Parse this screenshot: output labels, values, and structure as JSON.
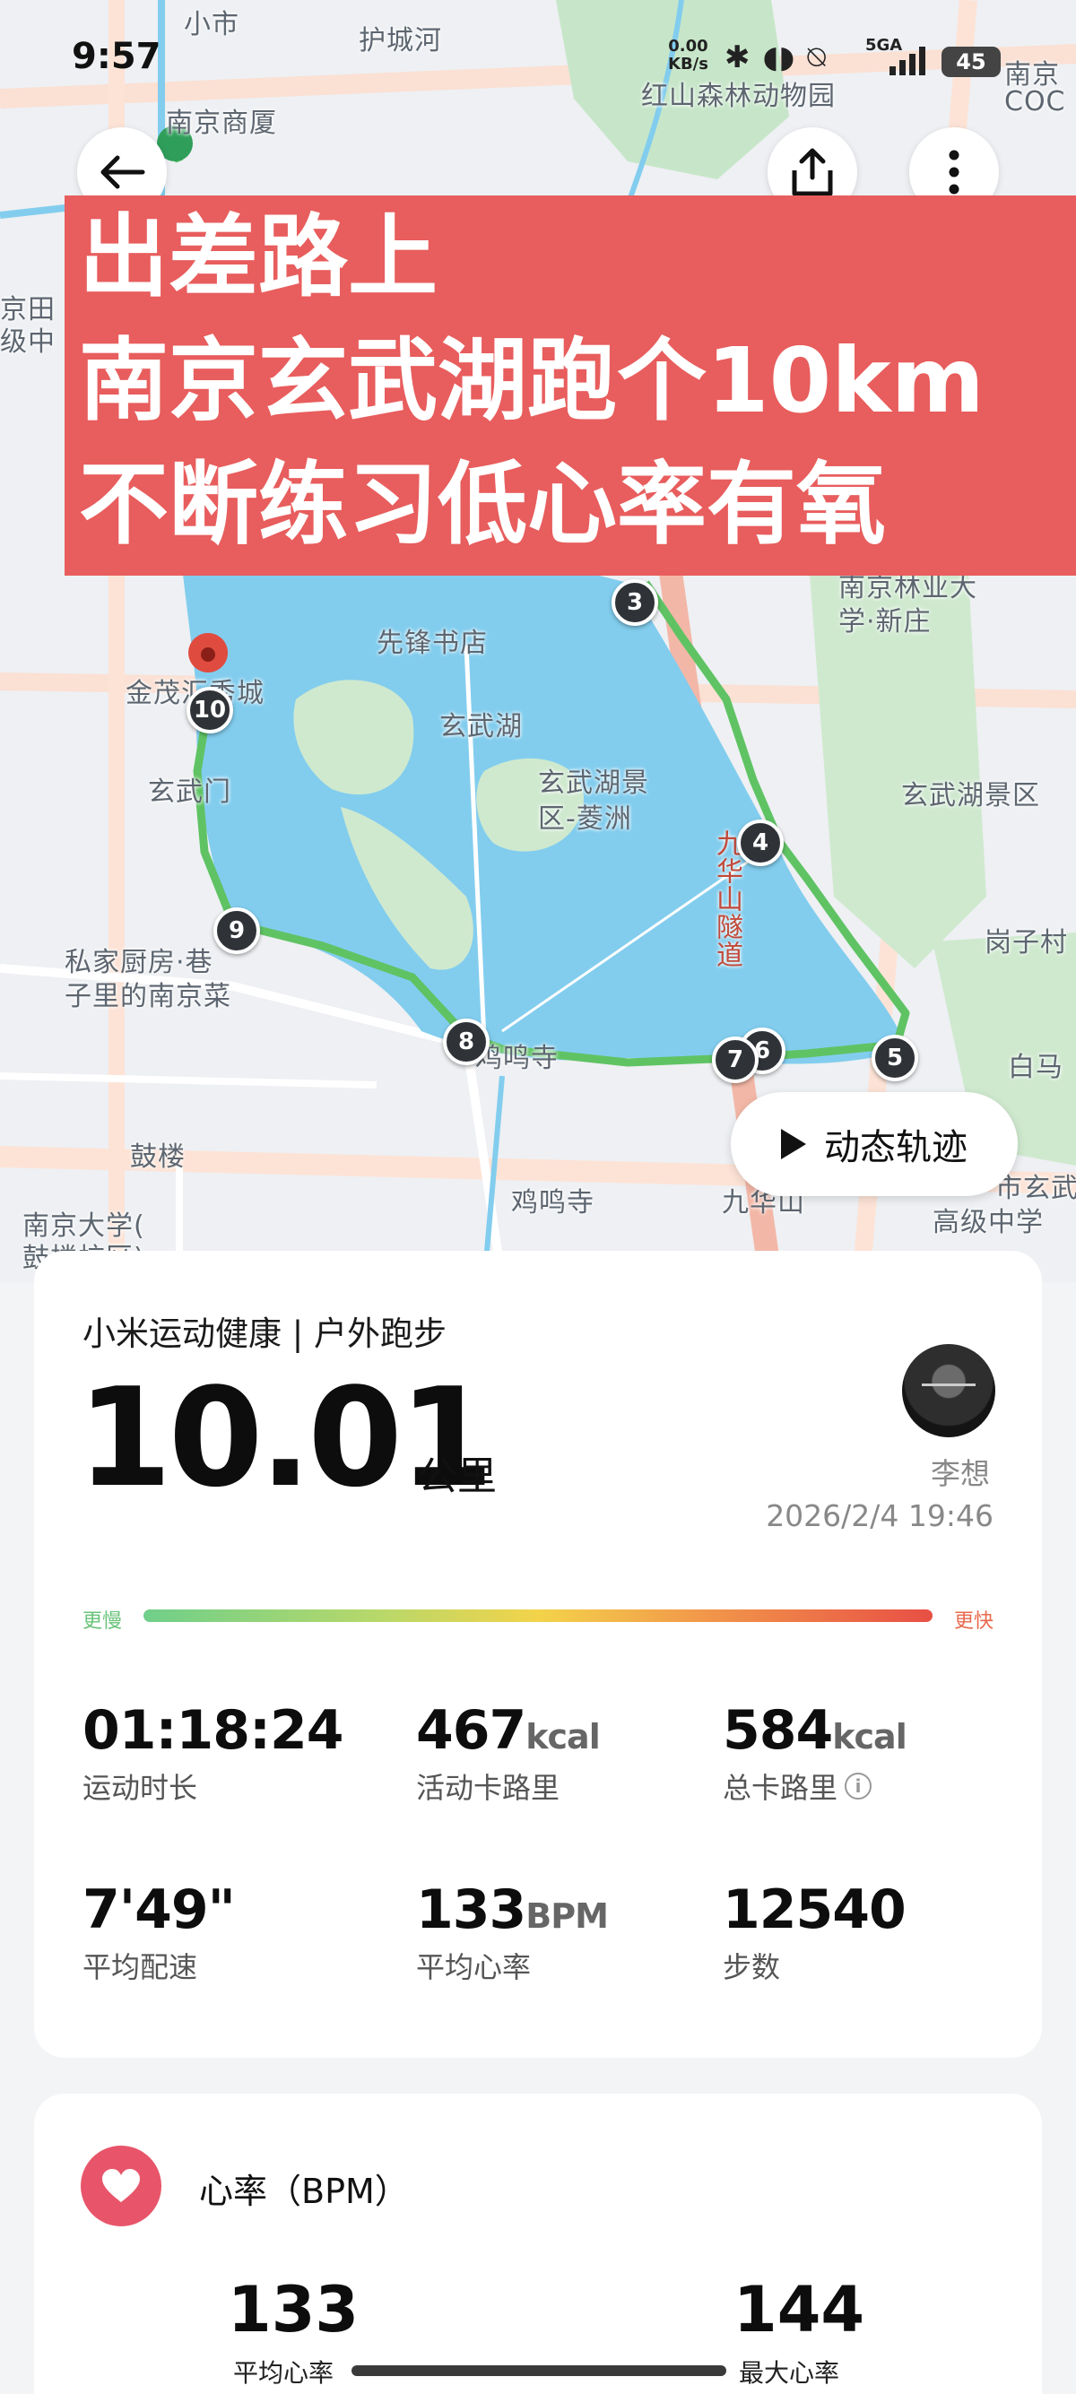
{
  "status_bar": {
    "time": "9:57",
    "net_speed_value": "0.00",
    "net_speed_unit": "KB/s",
    "network": "5GA",
    "battery": "45"
  },
  "map": {
    "labels": [
      "小市",
      "护城河",
      "红山森林动物园",
      "南京商厦",
      "南京",
      "COC",
      "京田",
      "级中",
      "南京林业大",
      "学·新庄",
      "先锋书店",
      "金茂汇秀城",
      "玄武湖",
      "玄武湖景",
      "区-菱洲",
      "玄武门",
      "玄武湖景区",
      "岗子村",
      "私家厨房·巷",
      "子里的南京菜",
      "九华山隧道",
      "鸡鸣寺",
      "白马",
      "鼓楼",
      "鸡鸣寺",
      "九华山",
      "市玄武",
      "高级中学",
      "南京大学(",
      "鼓楼校区)"
    ],
    "markers": [
      "3",
      "4",
      "5",
      "6",
      "7",
      "8",
      "9",
      "10"
    ]
  },
  "overlay": {
    "line1": "出差路上",
    "line2": "南京玄武湖跑个10km",
    "line3": "不断练习低心率有氧"
  },
  "track_button": "动态轨迹",
  "summary": {
    "source": "小米运动健康 | 户外跑步",
    "distance": "10.01",
    "distance_unit": "公里",
    "user_name": "李想",
    "datetime": "2026/2/4 19:46",
    "pace_slow": "更慢",
    "pace_fast": "更快",
    "stats": [
      {
        "value": "01:18:24",
        "unit": "",
        "label": "运动时长"
      },
      {
        "value": "467",
        "unit": "kcal",
        "label": "活动卡路里"
      },
      {
        "value": "584",
        "unit": "kcal",
        "label": "总卡路里"
      },
      {
        "value": "7'49\"",
        "unit": "",
        "label": "平均配速"
      },
      {
        "value": "133",
        "unit": "BPM",
        "label": "平均心率"
      },
      {
        "value": "12540",
        "unit": "",
        "label": "步数"
      }
    ]
  },
  "heart_rate": {
    "title": "心率（BPM）",
    "avg_value": "133",
    "avg_label": "平均心率",
    "max_value": "144",
    "max_label": "最大心率"
  }
}
